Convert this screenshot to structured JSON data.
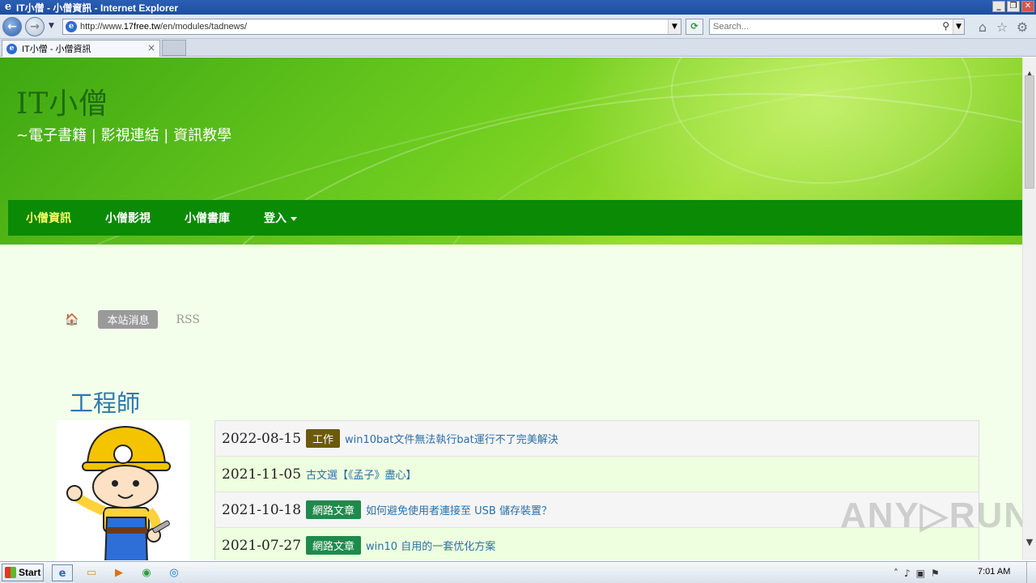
{
  "window": {
    "title": "IT小僧 - 小僧資訊 - Internet Explorer",
    "min": "_",
    "max": "❐",
    "close": "✕"
  },
  "toolbar": {
    "back": "←",
    "forward": "→",
    "address_prefix": "http://www.",
    "address_domain": "17free.tw",
    "address_suffix": "/en/modules/tadnews/",
    "search_placeholder": "Search...",
    "refresh": "⟳",
    "home_icon": "⌂",
    "favorites_icon": "☆",
    "tools_icon": "⚙"
  },
  "tabs": [
    {
      "label": "IT小僧 - 小僧資訊",
      "close": "×"
    }
  ],
  "site": {
    "title": "IT小僧",
    "slogan": "~電子書籍 | 影視連結 | 資訊教學",
    "nav": [
      {
        "label": "小僧資訊"
      },
      {
        "label": "小僧影視"
      },
      {
        "label": "小僧書庫"
      },
      {
        "label": "登入"
      }
    ]
  },
  "breadcrumb": {
    "home_icon": "🏠",
    "current": "本站消息",
    "rss": "RSS"
  },
  "category": {
    "title": "工程師"
  },
  "news": [
    {
      "date": "2022-08-15",
      "tag": "工作",
      "tag_color": "#6b5a0a",
      "title": "win10bat文件無法執行bat運行不了完美解決"
    },
    {
      "date": "2021-11-05",
      "tag": "",
      "tag_color": "",
      "title": "古文選【《孟子》盡心】"
    },
    {
      "date": "2021-10-18",
      "tag": "網路文章",
      "tag_color": "#1e8a4c",
      "title": "如何避免使用者連接至 USB 儲存裝置？"
    },
    {
      "date": "2021-07-27",
      "tag": "網路文章",
      "tag_color": "#1e8a4c",
      "title": "win10 自用的一套优化方案"
    }
  ],
  "watermark": "ANY▷RUN",
  "taskbar": {
    "start": "Start",
    "time": "7:01 AM"
  },
  "colors": {
    "nav_bg": "#0a8a05",
    "nav_active": "#ffff66",
    "link": "#2a6fa8",
    "category_title": "#2a7ab0"
  }
}
